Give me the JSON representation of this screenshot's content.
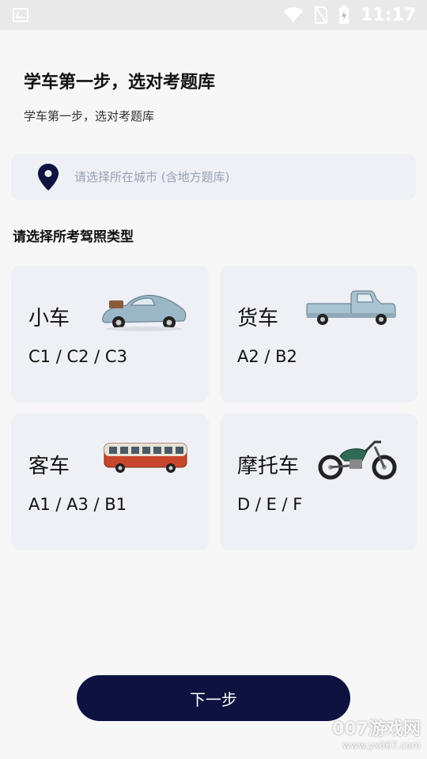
{
  "status_bar": {
    "time": "11:17"
  },
  "header": {
    "title": "学车第一步，选对考题库",
    "subtitle": "学车第一步，选对考题库"
  },
  "city": {
    "placeholder": "请选择所在城市 (含地方题库)"
  },
  "section_label": "请选择所考驾照类型",
  "license_types": [
    {
      "name": "小车",
      "codes": "C1 / C2 / C3",
      "icon": "car-icon"
    },
    {
      "name": "货车",
      "codes": "A2 / B2",
      "icon": "truck-icon"
    },
    {
      "name": "客车",
      "codes": "A1 / A3 / B1",
      "icon": "bus-icon"
    },
    {
      "name": "摩托车",
      "codes": "D / E / F",
      "icon": "motorcycle-icon"
    }
  ],
  "next_button": "下一步",
  "watermark": {
    "main": "007游戏网",
    "sub": "www.yx007.com"
  },
  "colors": {
    "primary": "#0e1240",
    "card_bg": "#eef0f5",
    "page_bg": "#f7f7f7"
  }
}
